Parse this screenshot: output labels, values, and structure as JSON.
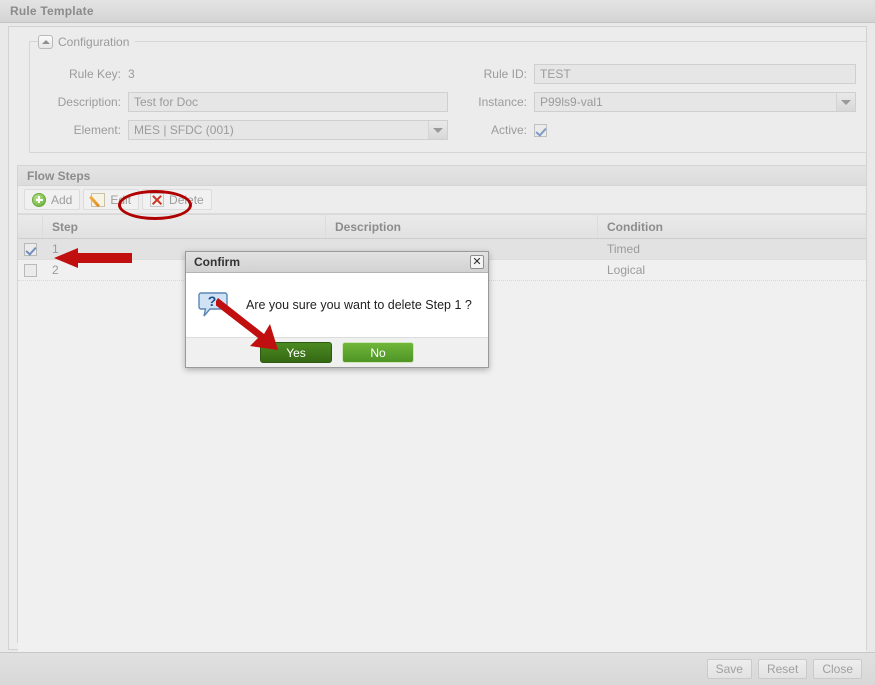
{
  "window": {
    "title": "Rule Template"
  },
  "configuration": {
    "legend": "Configuration",
    "collapse_icon": "triangle-up-icon",
    "fields": {
      "rule_key_label": "Rule Key:",
      "rule_key_value": "3",
      "description_label": "Description:",
      "description_value": "Test for Doc",
      "element_label": "Element:",
      "element_value": "MES | SFDC (001)",
      "rule_id_label": "Rule ID:",
      "rule_id_value": "TEST",
      "instance_label": "Instance:",
      "instance_value": "P99ls9-val1",
      "active_label": "Active:",
      "active_checked": true
    }
  },
  "flow_steps": {
    "header": "Flow Steps",
    "toolbar": [
      {
        "label": "Add",
        "icon": "add-plus-icon"
      },
      {
        "label": "Edit",
        "icon": "pencil-edit-icon"
      },
      {
        "label": "Delete",
        "icon": "delete-x-icon"
      }
    ],
    "columns": [
      "",
      "Step",
      "Description",
      "Condition"
    ],
    "rows": [
      {
        "checked": true,
        "step": "1",
        "description": "",
        "condition": "Timed"
      },
      {
        "checked": false,
        "step": "2",
        "description": "",
        "condition": "Logical"
      }
    ]
  },
  "dialog": {
    "title": "Confirm",
    "close_icon": "close-x-icon",
    "icon": "question-bubble-icon",
    "message": "Are you sure you want to delete Step 1 ?",
    "yes_label": "Yes",
    "no_label": "No"
  },
  "footer": {
    "buttons": [
      "Save",
      "Reset",
      "Close"
    ]
  },
  "annotations": {
    "ellipse_target": "Delete",
    "arrow_row_target": "Step 1 row",
    "arrow_button_target": "Yes",
    "color": "#b00000"
  }
}
